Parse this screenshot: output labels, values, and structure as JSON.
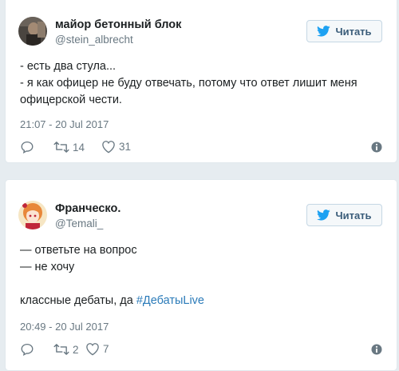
{
  "tweets": [
    {
      "name": "майор бетонный блок",
      "handle": "@stein_albrecht",
      "follow_label": "Читать",
      "lines": [
        "- есть два стула...",
        "- я как офицер не буду отвечать, потому что ответ лишит меня офицерской чести."
      ],
      "date": "21:07 - 20 Jul 2017",
      "retweets": "14",
      "likes": "31"
    },
    {
      "name": "Франческо.",
      "handle": "@Temali_",
      "follow_label": "Читать",
      "lines": [
        "— ответьте на вопрос",
        "— не хочу"
      ],
      "closing_text": "классные дебаты, да ",
      "hashtag": "#ДебатыLive",
      "date": "20:49 - 20 Jul 2017",
      "retweets": "2",
      "likes": "7"
    }
  ],
  "icons": {
    "bird": "twitter-bird-icon",
    "reply": "reply-icon",
    "retweet": "retweet-icon",
    "like": "heart-icon",
    "info": "info-icon"
  },
  "colors": {
    "link": "#2b7bb9",
    "follow_bird": "#1da1f2",
    "muted": "#697882"
  }
}
